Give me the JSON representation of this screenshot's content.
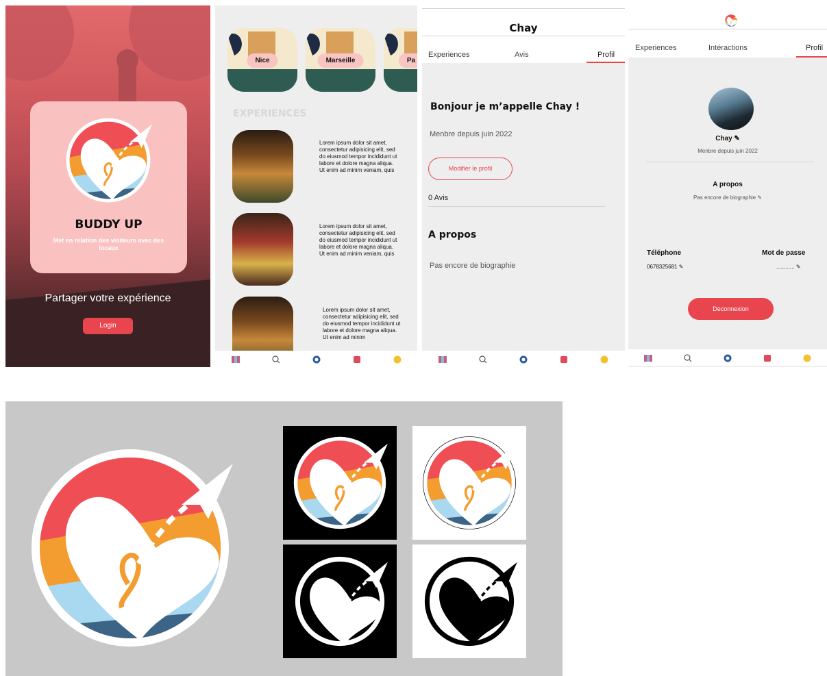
{
  "splash": {
    "brand": "BUDDY UP",
    "tagline": "Met en relation des visiteurs avec des locaux",
    "share": "Partager votre expérience",
    "login": "Login"
  },
  "explore": {
    "cities": [
      "Nice",
      "Marseille",
      "Pa"
    ],
    "section": "EXPERIENCES",
    "items": [
      {
        "text": "Lorem ipsum dolor sit amet, consectetur adipisicing elit, sed do eiusmod tempor incididunt ut labore et dolore magna aliqua. Ut enim ad minim veniam, quis"
      },
      {
        "text": "Lorem ipsum dolor sit amet, consectetur adipisicing elit, sed do eiusmod tempor incididunt ut labore et dolore magna aliqua. Ut enim ad minim veniam, quis"
      },
      {
        "text": "Lorem ipsum dolor sit amet, consectetur adipisicing elit, sed do eiusmod tempor incididunt ut labore et dolore magna aliqua. Ut enim ad minim"
      }
    ]
  },
  "profile": {
    "name": "Chay",
    "tabs": [
      "Experiences",
      "Avis",
      "Profil"
    ],
    "greeting": "Bonjour je m’appelle Chay !",
    "since": "Menbre depuis juin 2022",
    "edit": "Modifier le profil",
    "reviews": "0 Avis",
    "about_title": "A propos",
    "bio": "Pas encore de biographie"
  },
  "settings": {
    "tabs": [
      "Experiences",
      "Intéractions",
      "Profil"
    ],
    "name": "Chay",
    "since": "Menbre depuis juin 2022",
    "about_title": "A propos",
    "bio": "Pas encore de biographie",
    "phone_label": "Téléphone",
    "phone_value": "0678325681",
    "password_label": "Mot de passe",
    "password_value": "............",
    "logout": "Deconnexion"
  },
  "colors": {
    "accent": "#e8454f",
    "logo_red": "#ef4e55",
    "logo_orange": "#f39c2f",
    "logo_blue": "#a9d8f1",
    "logo_navy": "#3b6486",
    "card_pink": "#f9c1c0"
  },
  "nav_icons": [
    "map-icon",
    "search-icon",
    "compass-icon",
    "heart-icon",
    "smiley-icon"
  ]
}
